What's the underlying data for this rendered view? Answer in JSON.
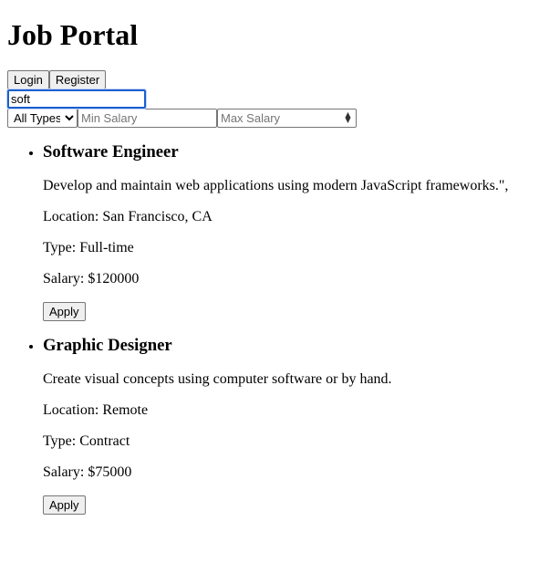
{
  "header": {
    "title": "Job Portal"
  },
  "auth": {
    "login_label": "Login",
    "register_label": "Register"
  },
  "search": {
    "value": "soft"
  },
  "filters": {
    "type_options": [
      "All Types"
    ],
    "type_selected": "All Types",
    "min_salary_placeholder": "Min Salary",
    "max_salary_placeholder": "Max Salary"
  },
  "jobs": [
    {
      "title": "Software Engineer",
      "description": "Develop and maintain web applications using modern JavaScript frameworks.\",",
      "location": "Location: San Francisco, CA",
      "type": "Type: Full-time",
      "salary": "Salary: $120000",
      "apply_label": "Apply"
    },
    {
      "title": "Graphic Designer",
      "description": "Create visual concepts using computer software or by hand.",
      "location": "Location: Remote",
      "type": "Type: Contract",
      "salary": "Salary: $75000",
      "apply_label": "Apply"
    }
  ],
  "icons": {
    "select_arrow": "chevron-down-icon",
    "spinner": "number-spinner-icon"
  }
}
